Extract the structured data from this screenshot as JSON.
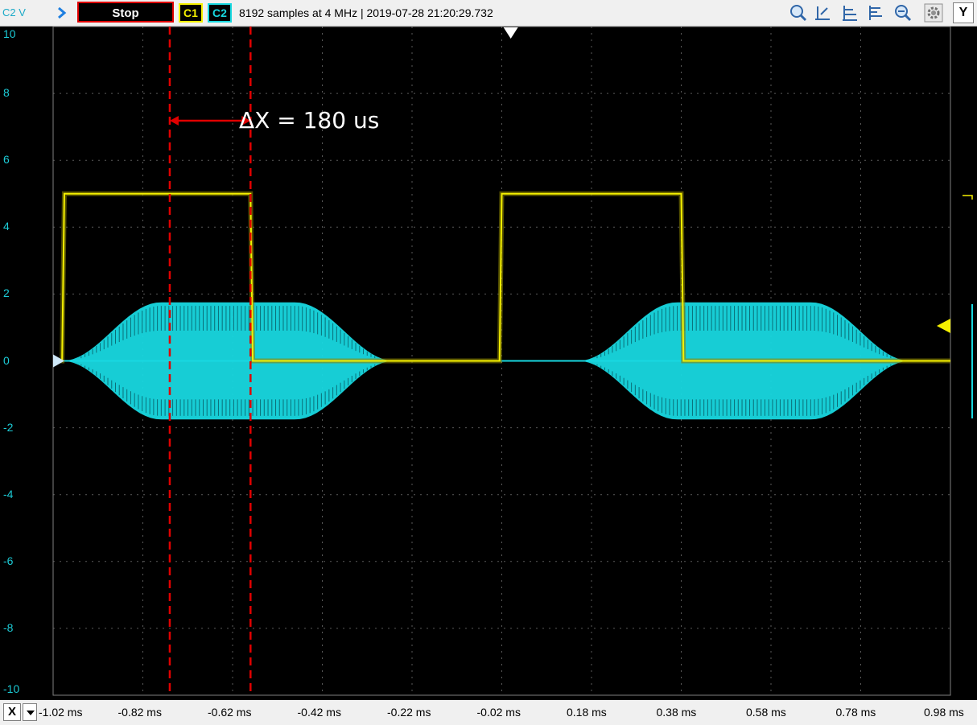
{
  "toolbar": {
    "channel_unit_label": "C2 V",
    "stop_label": "Stop",
    "c1_label": "C1",
    "c2_label": "C2",
    "acquisition_info": "8192 samples at 4 MHz | 2019-07-28 21:20:29.732",
    "y_label": "Y",
    "icons": [
      "zoom-in-icon",
      "cursor-up-icon",
      "align-icon",
      "align-list-icon",
      "zoom-out-icon",
      "settings-gear-icon"
    ]
  },
  "x_axis": {
    "button_label": "X",
    "ticks": [
      "-1.02 ms",
      "-0.82 ms",
      "-0.62 ms",
      "-0.42 ms",
      "-0.22 ms",
      "-0.02 ms",
      "0.18 ms",
      "0.38 ms",
      "0.58 ms",
      "0.78 ms",
      "0.98 ms"
    ]
  },
  "y_axis": {
    "ticks": [
      "10",
      "8",
      "6",
      "4",
      "2",
      "0",
      "-2",
      "-4",
      "-6",
      "-8",
      "-10"
    ]
  },
  "measurement": {
    "delta_label": "ΔX = 180 us"
  },
  "colors": {
    "c1": "#f5f000",
    "c2": "#18d8e0",
    "cursor": "#e00000",
    "grid": "#5a5a5a"
  },
  "chart_data": {
    "type": "line",
    "x_unit": "ms",
    "xlim": [
      -1.02,
      0.98
    ],
    "ylim": [
      -10,
      10
    ],
    "cursors_ms": [
      -0.76,
      -0.58
    ],
    "series": [
      {
        "name": "C1",
        "x": [
          -1.02,
          -1.0,
          -0.995,
          -0.58,
          -0.575,
          -0.025,
          -0.02,
          0.38,
          0.385,
          0.98
        ],
        "y": [
          0,
          0,
          5,
          5,
          0,
          0,
          5,
          5,
          0,
          0
        ]
      },
      {
        "name": "C2 envelope",
        "bursts": [
          {
            "start": -1.0,
            "ramp_end": -0.78,
            "hold_end": -0.48,
            "end": -0.26,
            "amplitude": 1.75
          },
          {
            "start": 0.15,
            "ramp_end": 0.37,
            "hold_end": 0.67,
            "end": 0.89,
            "amplitude": 1.75
          }
        ]
      }
    ]
  }
}
